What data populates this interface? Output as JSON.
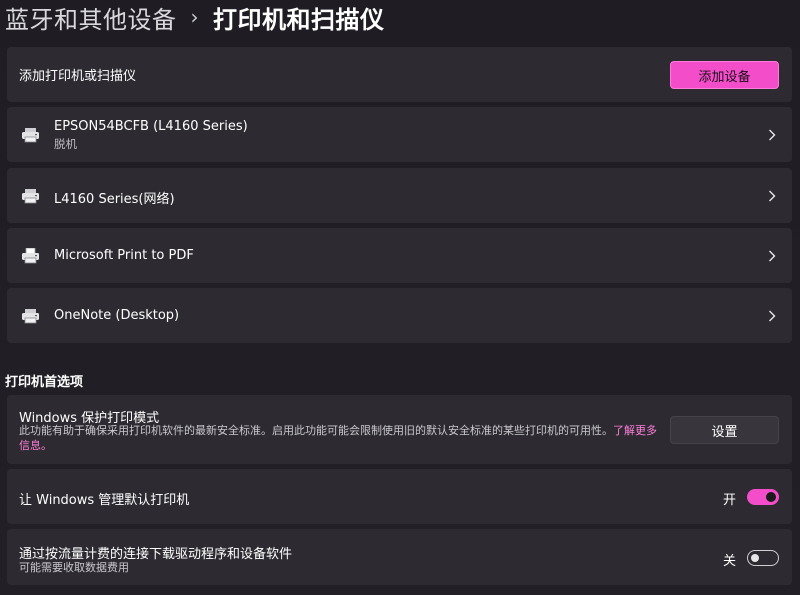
{
  "breadcrumb": {
    "parent": "蓝牙和其他设备",
    "separator": "›",
    "current": "打印机和扫描仪"
  },
  "add_device": {
    "label": "添加打印机或扫描仪",
    "button": "添加设备"
  },
  "printers": [
    {
      "name": "EPSON54BCFB (L4160 Series)",
      "status": "脱机",
      "icon": "printer-icon"
    },
    {
      "name": "L4160 Series(网络)",
      "status": "",
      "icon": "printer-icon"
    },
    {
      "name": "Microsoft Print to PDF",
      "status": "",
      "icon": "pdf-printer-icon"
    },
    {
      "name": "OneNote (Desktop)",
      "status": "",
      "icon": "printer-icon"
    }
  ],
  "preferences": {
    "title": "打印机首选项",
    "protected_mode": {
      "title": "Windows 保护打印模式",
      "desc": "此功能有助于确保采用打印机软件的最新安全标准。启用此功能可能会限制使用旧的默认安全标准的某些打印机的可用性。",
      "link": "了解更多信息。",
      "button": "设置"
    },
    "manage_default": {
      "title": "让 Windows 管理默认打印机",
      "state_label": "开",
      "on": true
    },
    "metered_download": {
      "title": "通过按流量计费的连接下载驱动程序和设备软件",
      "desc": "可能需要收取数据费用",
      "state_label": "关",
      "on": false
    }
  },
  "colors": {
    "accent": "#f34dc9",
    "background": "#211e24",
    "card": "#2d2b31",
    "link": "#ff7fd9"
  }
}
